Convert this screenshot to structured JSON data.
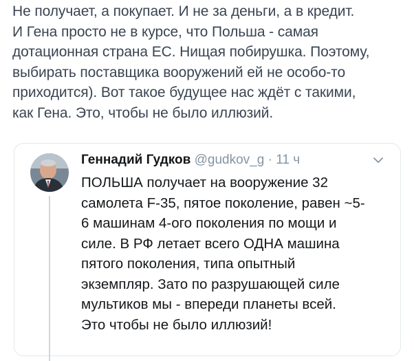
{
  "tweet": {
    "lines": [
      "Не получает, а покупает. И не за деньги, а в кредит.",
      "И Гена просто не в курсе, что Польша - самая",
      "дотационная страна ЕС. Нищая побирушка. Поэтому,",
      "выбирать поставщика вооружений ей не особо-то",
      "приходится). Вот такое будущее нас ждёт с такими,",
      "как Гена. Это, чтобы не было иллюзий."
    ]
  },
  "quoted_tweet": {
    "author_name": "Геннадий Гудков",
    "handle": "@gudkov_g",
    "separator": "·",
    "time": "11 ч",
    "avatar_icon": "user-photo-avatar",
    "menu_icon": "chevron-down-icon",
    "lines": [
      "ПОЛЬША получает на вооружение 32",
      "самолета F-35, пятое поколение, равен ~5-",
      "6 машинам 4-ого поколения по мощи и",
      "силе. В РФ летает всего ОДНА машина",
      "пятого поколения, типа опытный",
      "экземпляр. Зато по разрушающей силе",
      "мультиков мы - впереди планеты всей.",
      "Это чтобы не было иллюзий!"
    ]
  },
  "colors": {
    "text_muted": "#8494a3",
    "text_main": "#14171a",
    "border": "#e1e8ed",
    "thread_line": "#ccd6dd"
  }
}
